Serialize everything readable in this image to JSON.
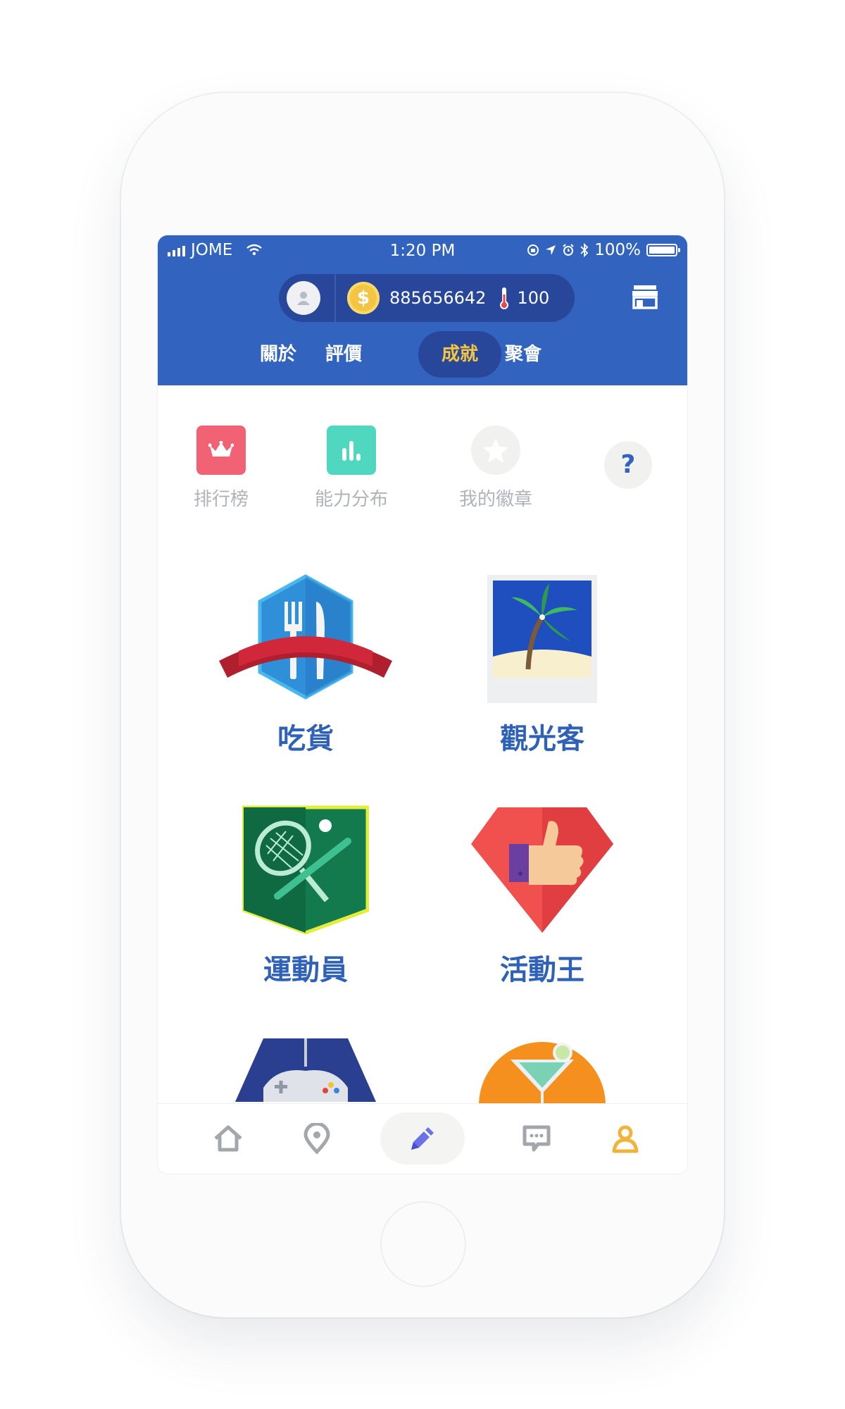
{
  "status_bar": {
    "carrier": "JOME",
    "time": "1:20 PM",
    "battery": "100%",
    "battery_level": 1.0
  },
  "header": {
    "coins": "885656642",
    "temperature": "100",
    "tabs": [
      {
        "label": "關於",
        "active": false
      },
      {
        "label": "評價",
        "active": false
      },
      {
        "label": "成就",
        "active": true
      },
      {
        "label": "聚會",
        "active": false
      }
    ]
  },
  "quick_actions": [
    {
      "label": "排行榜",
      "icon": "crown-icon",
      "color": "#f06274"
    },
    {
      "label": "能力分布",
      "icon": "bar-chart-icon",
      "color": "#4fd8bf"
    },
    {
      "label": "我的徽章",
      "icon": "star-icon",
      "color": "#f1f2ef"
    }
  ],
  "help": {
    "label": "?"
  },
  "badges": [
    {
      "label": "吃貨",
      "icon": "fork-knife-badge-icon"
    },
    {
      "label": "觀光客",
      "icon": "palm-tree-badge-icon"
    },
    {
      "label": "運動員",
      "icon": "tennis-baseball-badge-icon"
    },
    {
      "label": "活動王",
      "icon": "thumbs-up-badge-icon"
    },
    {
      "label": "",
      "icon": "gamepad-badge-icon"
    },
    {
      "label": "",
      "icon": "cocktail-badge-icon"
    }
  ],
  "bottom_nav": [
    {
      "icon": "home-icon"
    },
    {
      "icon": "location-pin-icon"
    },
    {
      "icon": "pencil-icon"
    },
    {
      "icon": "chat-icon"
    },
    {
      "icon": "profile-icon"
    }
  ],
  "colors": {
    "header_blue": "#3264bf",
    "pill_dark_blue": "#28479b",
    "active_tab_text": "#f4c542",
    "badge_label": "#2f62b6",
    "active_nav": "#6a72e8",
    "profile_nav": "#f0b43c"
  }
}
